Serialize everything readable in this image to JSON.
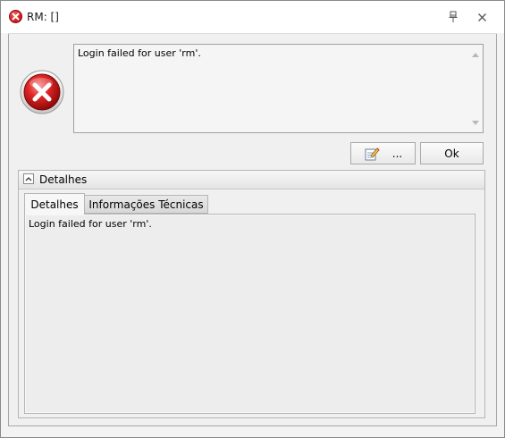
{
  "window": {
    "title": "RM: []"
  },
  "message": {
    "text": "Login failed for user 'rm'."
  },
  "buttons": {
    "more_label": "...",
    "ok_label": "Ok"
  },
  "details": {
    "header_label": "Detalhes",
    "tabs": [
      {
        "label": "Detalhes",
        "selected": true
      },
      {
        "label": "Informações Técnicas",
        "selected": false
      }
    ],
    "content_text": "Login failed for user 'rm'."
  },
  "icons": {
    "title_icon": "error-icon",
    "main_icon": "error-icon",
    "pin_button": "pin-icon",
    "close_button": "close-icon",
    "notes_button": "notes-edit-icon",
    "collapse": "chevron-up-icon"
  },
  "colors": {
    "error_red": "#d61a1a",
    "window_bg": "#f3f3f3",
    "border": "#a7a7a7"
  }
}
